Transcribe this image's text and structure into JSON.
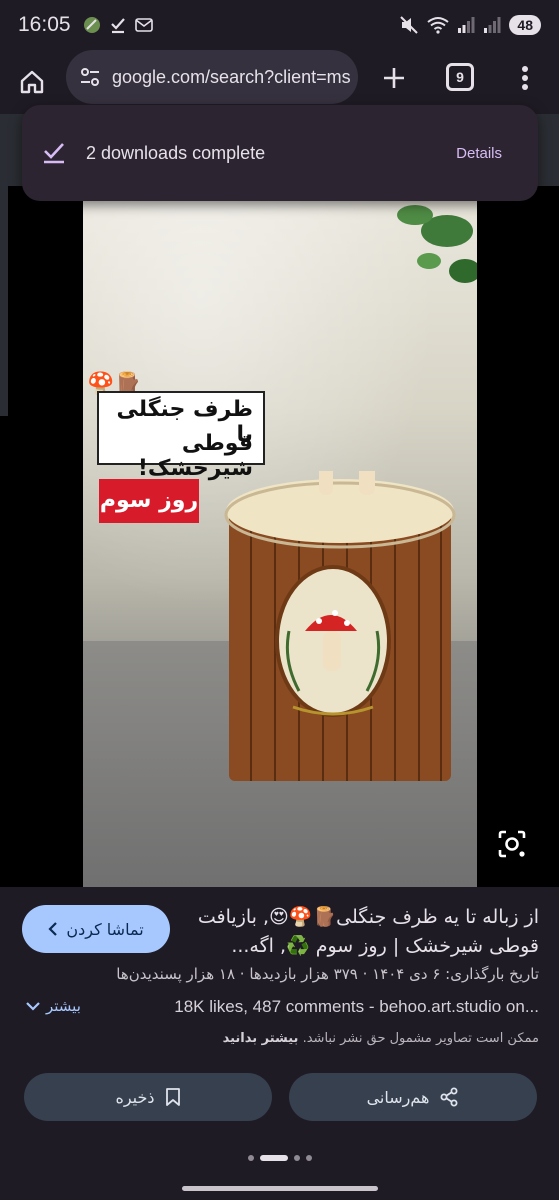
{
  "status_bar": {
    "time": "16:05",
    "battery": "48",
    "icons": [
      "leaf-app-icon",
      "download-done-icon",
      "mail-icon",
      "mute-icon",
      "wifi-icon",
      "signal-icon",
      "signal-2-icon"
    ]
  },
  "browser": {
    "url": "google.com/search?client=ms",
    "tab_count": "9",
    "icons": [
      "home-icon",
      "site-settings-icon",
      "plus-icon",
      "more-vert-icon"
    ]
  },
  "snackbar": {
    "message": "2 downloads complete",
    "action": "Details"
  },
  "image": {
    "caption_line1": "ظرف جنگلی با",
    "caption_line2": "قوطی شیرخشک!",
    "day_label": "روز سوم",
    "corner_emoji": "🍄🪵"
  },
  "result": {
    "watch_button": "تماشا کردن",
    "title": "از زباله تا یه ظرف جنگلی🪵🍄😍, بازیافت قوطی شیرخشک | روز سوم ♻️, اگه...",
    "meta": "تاریخ بارگذاری: ۶ دی ۱۴۰۴ · ۳۷۹ هزار بازدیدها · ۱۸ هزار پسندیدن‌ها",
    "more_label": "بیشتر",
    "stats": "18K likes, 487 comments - behoo.art.studio on...",
    "copyright": "ممکن است تصاویر مشمول حق نشر نباشد.",
    "learn_more": "بیشتر بدانید",
    "share_label": "هم‌رسانی",
    "save_label": "ذخیره"
  },
  "pager": {
    "count": 4,
    "active_index": 1
  },
  "colors": {
    "background": "#1f1b24",
    "accent_button": "#a7c8ff",
    "snackbar": "#2c2531",
    "snackbar_action": "#d7bbf5",
    "day_label_bg": "#d81b2a"
  }
}
